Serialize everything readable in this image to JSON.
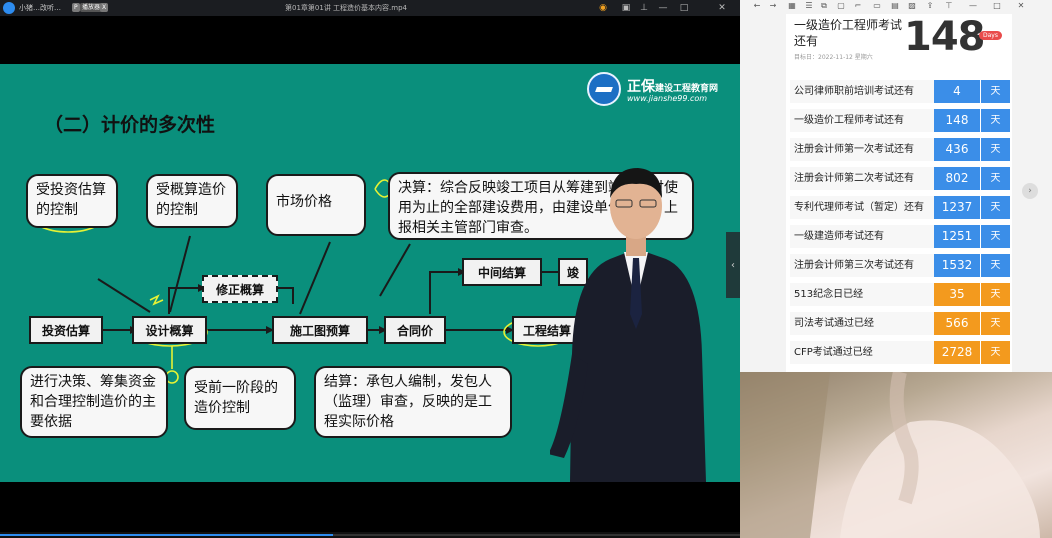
{
  "player": {
    "app_name": "小猪…改听…",
    "badge1": "P",
    "badge2": "播放器",
    "badge3": "X",
    "video_title": "第01章第01讲  工程造价基本内容.mp4",
    "icons": [
      "gamepad-icon",
      "screenshot-icon",
      "pin-icon",
      "minimize-icon",
      "maximize-icon",
      "close-icon"
    ],
    "progress_fraction": 0.45
  },
  "slide": {
    "brand": "正保",
    "brand_sub": "建设工程教育网",
    "url": "www.jianshe99.com",
    "heading": "（二）计价的多次性",
    "bubbles": {
      "investment_control": "受投资估算的控制",
      "budget_control": "受概算造价的控制",
      "market_price": "市场价格",
      "final_accounts": "决算：综合反映竣工项目从筹建到竣工交付使用为止的全部建设费用，由建设单位编制，上报相关主管部门审查。",
      "decision_basis": "进行决策、筹集资金和合理控制造价的主要依据",
      "prev_stage": "受前一阶段的造价控制",
      "settlement": "结算：承包人编制，发包人（监理）审查，反映的是工程实际价格"
    },
    "boxes": {
      "investment_estimate": "投资估算",
      "design_estimate": "设计概算",
      "revised_estimate": "修正概算",
      "construction_budget": "施工图预算",
      "contract_price": "合同价",
      "interim_settlement": "中间结算",
      "project_settlement": "工程结算",
      "final": "竣"
    }
  },
  "panel": {
    "exam_title": "一级造价工程师考试还有",
    "target_date": "目标日：2022-11-12 星期六",
    "big_number": "148",
    "days_label": "Days",
    "rows": [
      {
        "label": "公司律师职前培训考试还有",
        "value": "4",
        "unit": "天",
        "color": "#3b8ee8"
      },
      {
        "label": "一级造价工程师考试还有",
        "value": "148",
        "unit": "天",
        "color": "#3b8ee8"
      },
      {
        "label": "注册会计师第一次考试还有",
        "value": "436",
        "unit": "天",
        "color": "#3b8ee8"
      },
      {
        "label": "注册会计师第二次考试还有",
        "value": "802",
        "unit": "天",
        "color": "#3b8ee8"
      },
      {
        "label": "专利代理师考试（暂定）还有",
        "value": "1237",
        "unit": "天",
        "color": "#3b8ee8"
      },
      {
        "label": "一级建造师考试还有",
        "value": "1251",
        "unit": "天",
        "color": "#3b8ee8"
      },
      {
        "label": "注册会计师第三次考试还有",
        "value": "1532",
        "unit": "天",
        "color": "#3b8ee8"
      },
      {
        "label": "513纪念日已经",
        "value": "35",
        "unit": "天",
        "color": "#f39a1e"
      },
      {
        "label": "司法考试通过已经",
        "value": "566",
        "unit": "天",
        "color": "#f39a1e"
      },
      {
        "label": "CFP考试通过已经",
        "value": "2728",
        "unit": "天",
        "color": "#f39a1e"
      }
    ]
  }
}
